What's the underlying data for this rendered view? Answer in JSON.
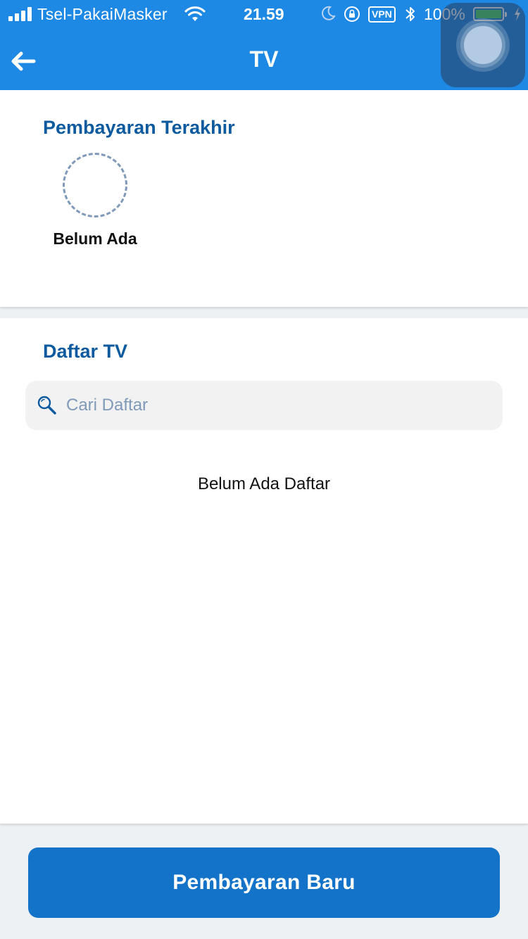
{
  "status_bar": {
    "carrier": "Tsel-PakaiMasker",
    "time": "21.59",
    "vpn_label": "VPN",
    "battery_percent": "100%",
    "battery_level": 1.0,
    "battery_color": "#4cd964"
  },
  "nav": {
    "title": "TV",
    "back_icon": "arrow-left-icon"
  },
  "recent_payments": {
    "title": "Pembayaran Terakhir",
    "empty_label": "Belum Ada"
  },
  "tv_list": {
    "title": "Daftar TV",
    "search": {
      "placeholder": "Cari Daftar",
      "value": "",
      "icon": "search-icon"
    },
    "empty_label": "Belum Ada Daftar"
  },
  "footer": {
    "primary_button_label": "Pembayaran Baru"
  },
  "colors": {
    "brand": "#1e88e5",
    "heading": "#0d5a9e",
    "button": "#1273c9"
  }
}
